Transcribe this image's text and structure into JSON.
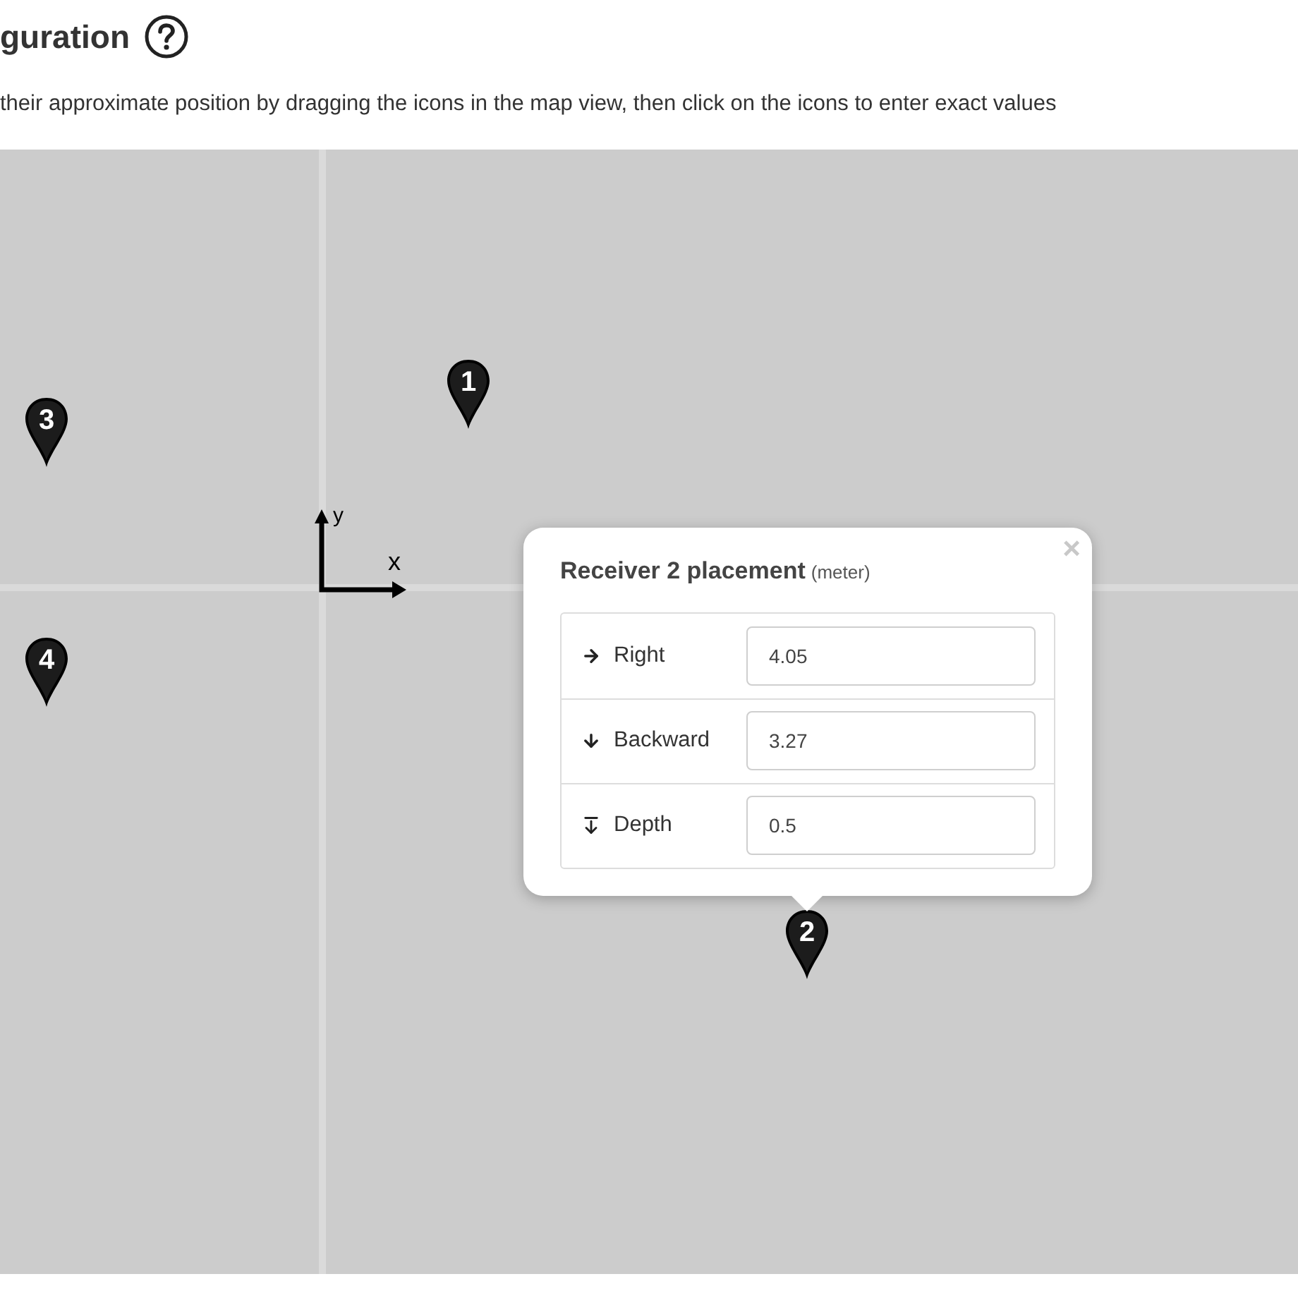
{
  "header": {
    "title": "guration",
    "instructions": "their approximate position by dragging the icons in the map view, then click on the icons to enter exact values"
  },
  "map": {
    "axes": {
      "y_label": "y",
      "x_label": "x"
    },
    "markers": [
      {
        "label": "1"
      },
      {
        "label": "3"
      },
      {
        "label": "4"
      },
      {
        "label": "2"
      }
    ]
  },
  "popup": {
    "title": "Receiver 2 placement",
    "unit": "(meter)",
    "close": "×",
    "fields": [
      {
        "kind": "right",
        "label": "Right",
        "value": "4.05"
      },
      {
        "kind": "backward",
        "label": "Backward",
        "value": "3.27"
      },
      {
        "kind": "depth",
        "label": "Depth",
        "value": "0.5"
      }
    ]
  }
}
